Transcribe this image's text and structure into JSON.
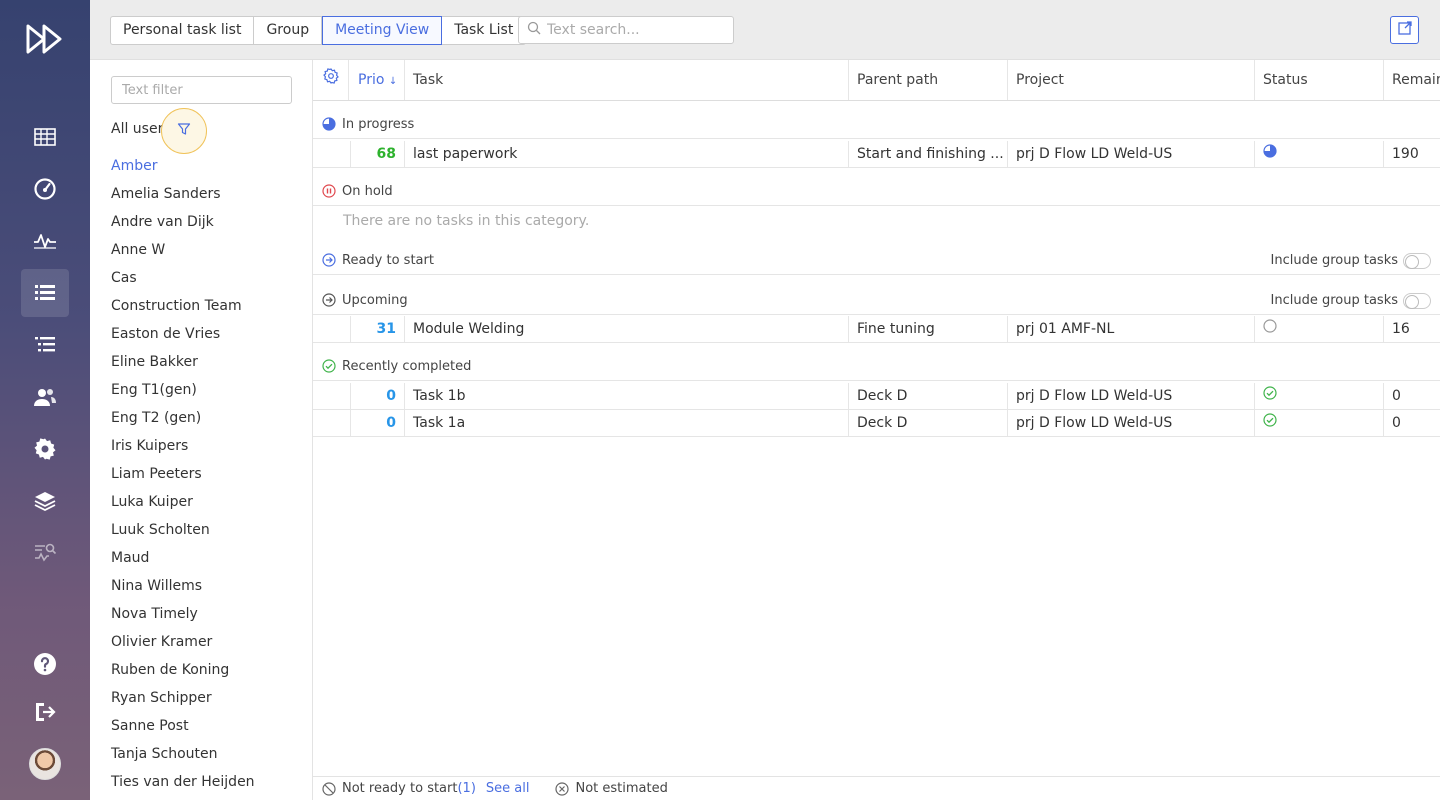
{
  "colors": {
    "accent": "#4a6ee0",
    "progress_green": "#2db22d",
    "prio_blue": "#2795e8",
    "hold_red": "#e0484e",
    "done_green": "#3fb34a"
  },
  "rail": {
    "icons": [
      "fast-forward-logo-icon",
      "calendar-grid-icon",
      "dashboard-gauge-icon",
      "activity-pulse-icon",
      "task-list-icon",
      "gantt-list-icon",
      "users-icon",
      "settings-gear-icon",
      "layers-icon",
      "analytics-icon",
      "help-icon",
      "logout-icon"
    ]
  },
  "topbar": {
    "tabs": [
      "Personal task list",
      "Group",
      "Meeting View",
      "Task List"
    ],
    "active_tab": "Meeting View",
    "search_placeholder": "Text search..."
  },
  "users": {
    "filter_placeholder": "Text filter",
    "all_users_label": "All users",
    "selected": "Amber",
    "list": [
      "Amber",
      "Amelia Sanders",
      "Andre van Dijk",
      "Anne W",
      "Cas",
      "Construction Team",
      "Easton de Vries",
      "Eline Bakker",
      "Eng T1(gen)",
      "Eng T2 (gen)",
      "Iris Kuipers",
      "Liam Peeters",
      "Luka Kuiper",
      "Luuk Scholten",
      "Maud",
      "Nina Willems",
      "Nova Timely",
      "Olivier Kramer",
      "Ruben de Koning",
      "Ryan Schipper",
      "Sanne Post",
      "Tanja Schouten",
      "Ties van der Heijden"
    ]
  },
  "table": {
    "headers": {
      "prio": "Prio",
      "sort_arrow": "↓",
      "task": "Task",
      "parent": "Parent path",
      "project": "Project",
      "status": "Status",
      "remain": "Remain"
    },
    "sections": {
      "in_progress": "In progress",
      "on_hold": "On hold",
      "ready": "Ready to start",
      "upcoming": "Upcoming",
      "completed": "Recently completed"
    },
    "include_group_tasks": "Include group tasks",
    "empty_message": "There are no tasks in this category.",
    "rows": {
      "r1": {
        "prio": "68",
        "task": "last paperwork",
        "parent": "Start and finishing ...",
        "project": "prj D Flow LD Weld-US",
        "remain": "190"
      },
      "r2": {
        "prio": "31",
        "task": "Module Welding",
        "parent": "Fine tuning",
        "project": "prj 01 AMF-NL",
        "remain": "16"
      },
      "r3": {
        "prio": "0",
        "task": "Task 1b",
        "parent": "Deck D",
        "project": "prj D Flow LD Weld-US",
        "remain": "0"
      },
      "r4": {
        "prio": "0",
        "task": "Task 1a",
        "parent": "Deck D",
        "project": "prj D Flow LD Weld-US",
        "remain": "0"
      }
    }
  },
  "footer": {
    "not_ready": "Not ready to start",
    "not_ready_count": "(1)",
    "see_all": "See all",
    "not_estimated": "Not estimated"
  }
}
